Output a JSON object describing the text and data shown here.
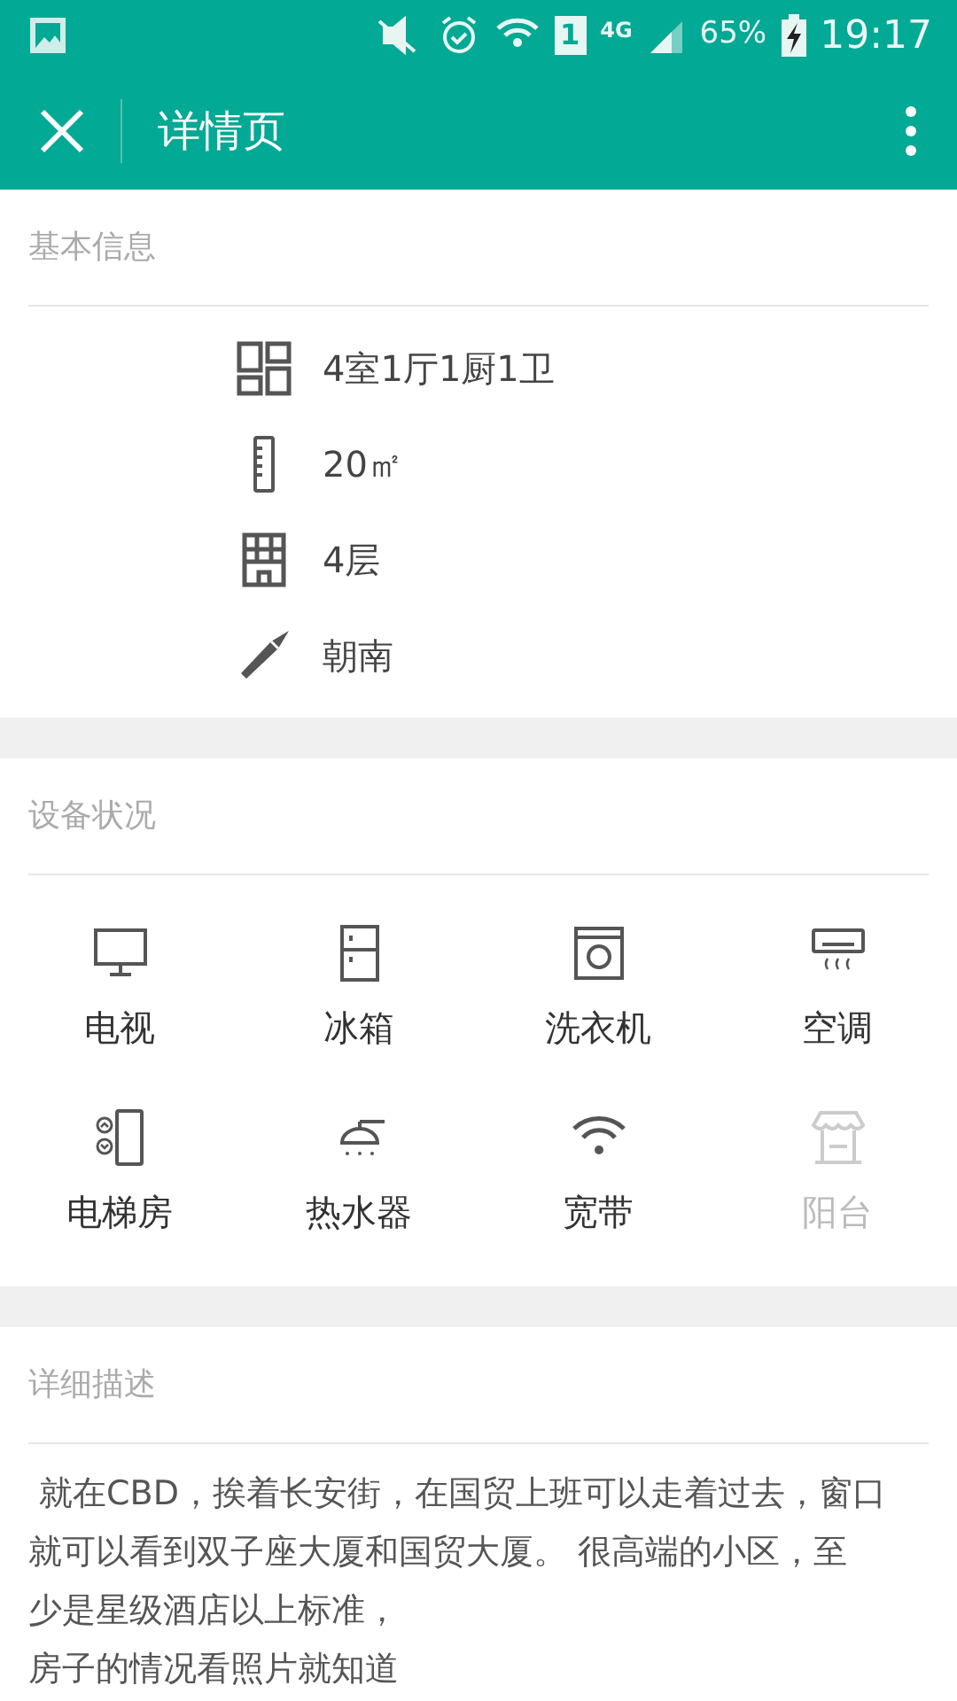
{
  "status_bar": {
    "signal_text": "4G",
    "sim": "1",
    "battery": "65%",
    "time": "19:17"
  },
  "header": {
    "title": "详情页"
  },
  "basic_info": {
    "title": "基本信息",
    "items": [
      {
        "kind": "rooms",
        "text": "4室1厅1厨1卫"
      },
      {
        "kind": "area",
        "text": "20㎡"
      },
      {
        "kind": "floor",
        "text": "4层"
      },
      {
        "kind": "orientation",
        "text": "朝南"
      }
    ]
  },
  "facilities": {
    "title": "设备状况",
    "items": [
      {
        "kind": "tv",
        "label": "电视",
        "available": true
      },
      {
        "kind": "fridge",
        "label": "冰箱",
        "available": true
      },
      {
        "kind": "washer",
        "label": "洗衣机",
        "available": true
      },
      {
        "kind": "aircon",
        "label": "空调",
        "available": true
      },
      {
        "kind": "elevator",
        "label": "电梯房",
        "available": true
      },
      {
        "kind": "water-heater",
        "label": "热水器",
        "available": true
      },
      {
        "kind": "broadband",
        "label": "宽带",
        "available": true
      },
      {
        "kind": "balcony",
        "label": "阳台",
        "available": false
      }
    ]
  },
  "description": {
    "title": "详细描述",
    "lines": [
      " 就在CBD，挨着长安街，在国贸上班可以走着过去，窗口",
      "就可以看到双子座大厦和国贸大厦。 很高端的小区，至",
      "少是星级酒店以上标准，",
      "房子的情况看照片就知道"
    ]
  }
}
